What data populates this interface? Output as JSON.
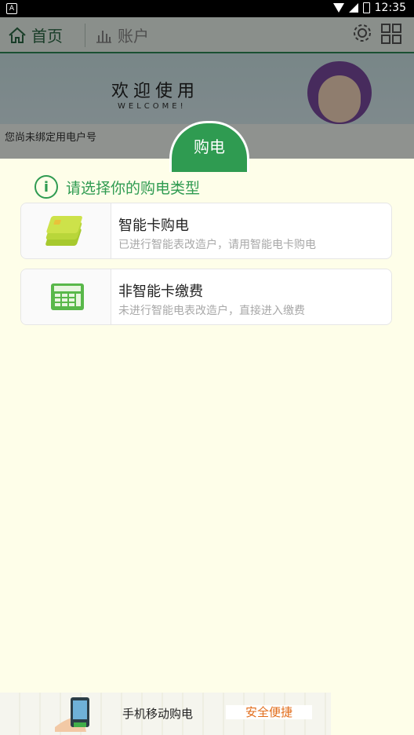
{
  "status_bar": {
    "time": "12:35",
    "notification_icon": "A"
  },
  "background_app": {
    "tabs": {
      "home": "首页",
      "account": "账户"
    },
    "banner": {
      "title": "欢迎使用",
      "subtitle": "WELCOME!"
    },
    "notice": "您尚未绑定用电户号"
  },
  "sheet": {
    "fab_label": "购电",
    "title": "请选择你的购电类型",
    "options": [
      {
        "title": "智能卡购电",
        "desc": "已进行智能表改造户，请用智能电卡购电",
        "icon": "smart-card-icon"
      },
      {
        "title": "非智能卡缴费",
        "desc": "未进行智能电表改造户，直接进入缴费",
        "icon": "calculator-icon"
      }
    ]
  },
  "ad": {
    "text": "手机移动购电",
    "highlight": "安全便捷"
  },
  "colors": {
    "accent": "#2f9b51",
    "dark_header": "#000000",
    "background": "#fefee9"
  }
}
